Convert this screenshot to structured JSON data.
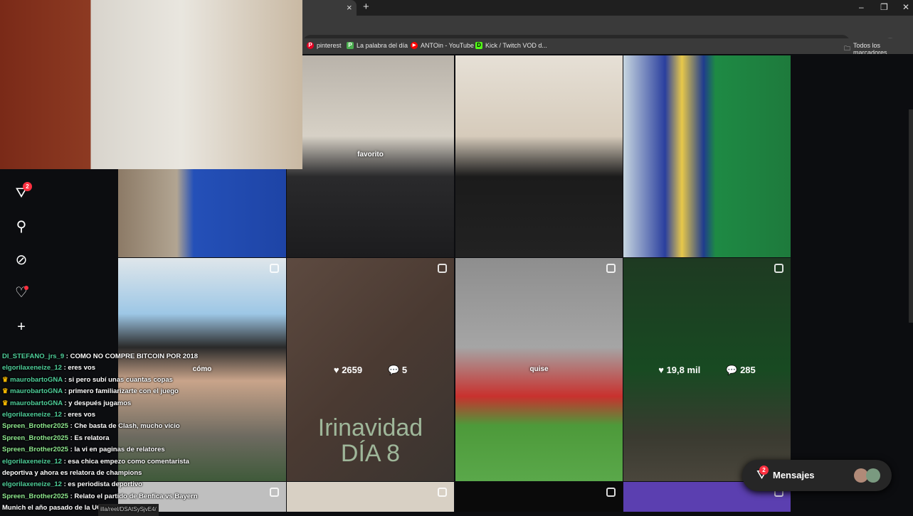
{
  "browser": {
    "tab_close": "×",
    "new_tab": "+",
    "minimize": "–",
    "restore": "❐",
    "close": "✕"
  },
  "bookmarks": [
    {
      "label": "pinterest",
      "icon": "P",
      "color": "#e60023"
    },
    {
      "label": "La palabra del día",
      "icon": "P",
      "color": "#4caf50"
    },
    {
      "label": "ANTOin - YouTube",
      "icon": "▶",
      "color": "#ff0000"
    },
    {
      "label": "Kick / Twitch VOD d...",
      "icon": "D",
      "color": "#53fc18"
    }
  ],
  "all_bookmarks": "Todos los marcadores",
  "nav": {
    "messages_badge": "2"
  },
  "grid": {
    "cells": [
      {
        "overlay": "favorito"
      },
      {
        "overlay": "cómo"
      },
      {
        "likes": "2659",
        "comments": "5",
        "overlay": "Irinavidad",
        "overlay2": "DÍA 8"
      },
      {
        "overlay": "quise"
      },
      {
        "likes": "19,8 mil",
        "comments": "285"
      }
    ]
  },
  "chat": [
    {
      "user": "DI_STEFANO_jrs_9",
      "text": "COMO NO COMPRE BITCOIN POR 2018",
      "cls": "u1"
    },
    {
      "user": "elgorilaxeneize_12",
      "text": "eres vos",
      "cls": "u1"
    },
    {
      "user": "maurobartoGNA",
      "text": "si pero subí unas cuantas copas",
      "cls": "u1",
      "crown": true
    },
    {
      "user": "maurobartoGNA",
      "text": "primero familiarizarte con el juego",
      "cls": "u1",
      "crown": true
    },
    {
      "user": "maurobartoGNA",
      "text": "y después jugamos",
      "cls": "u1",
      "crown": true
    },
    {
      "user": "elgorilaxeneize_12",
      "text": "eres vos",
      "cls": "u1"
    },
    {
      "user": "Spreen_Brother2025",
      "text": "Che basta de Clash, mucho vicio",
      "cls": "u2"
    },
    {
      "user": "Spreen_Brother2025",
      "text": "Es relatora",
      "cls": "u2"
    },
    {
      "user": "Spreen_Brother2025",
      "text": "la vi en paginas de relatores",
      "cls": "u2"
    },
    {
      "user": "elgorilaxeneize_12",
      "text": "esa chica empezo como comentarista deportiva y ahora es relatora de champions",
      "cls": "u1"
    },
    {
      "user": "elgorilaxeneize_12",
      "text": "es periodista deportivo",
      "cls": "u1"
    },
    {
      "user": "Spreen_Brother2025",
      "text": "Relato el partido de Benfica vs Bayern Munich el año pasado de la UCL",
      "cls": "u2"
    }
  ],
  "status_url": "illa/reel/DSAtSySjvE4/",
  "messages": {
    "label": "Mensajes",
    "badge": "2"
  }
}
